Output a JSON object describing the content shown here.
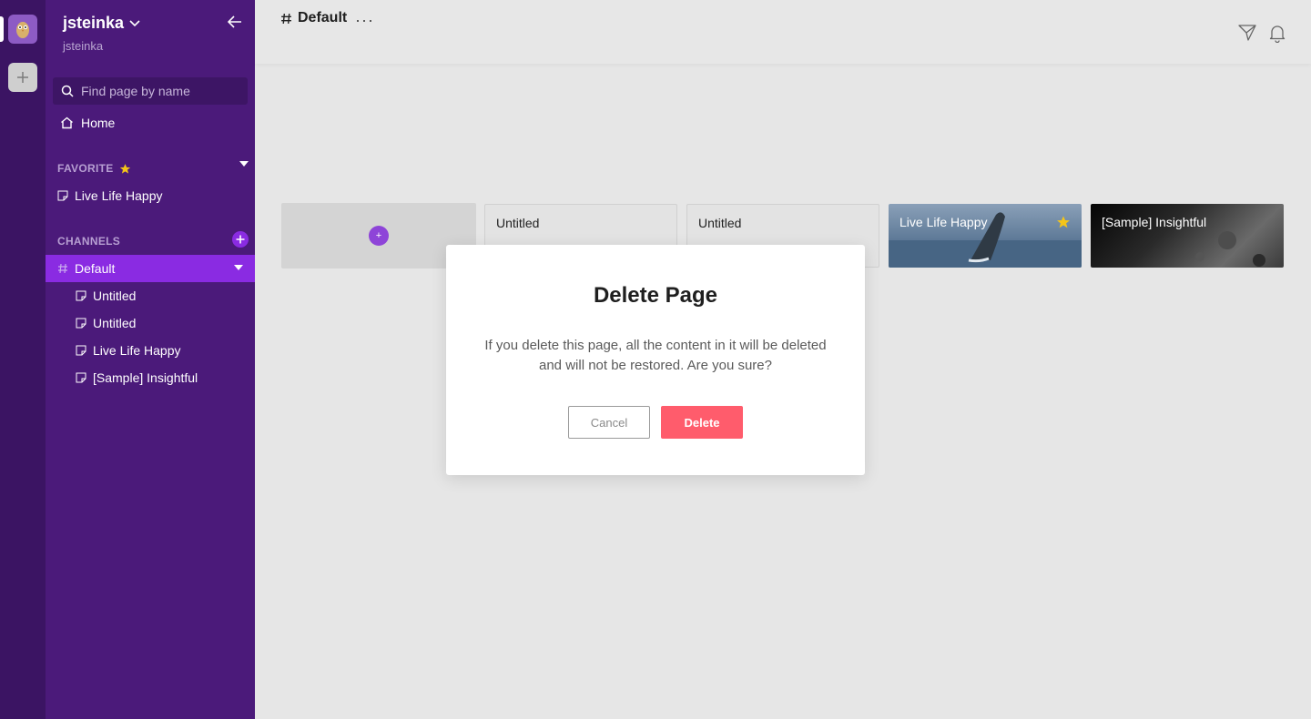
{
  "workspace": {
    "name": "jsteinka",
    "subtitle": "jsteinka"
  },
  "sidebar": {
    "search_placeholder": "Find page by name",
    "home_label": "Home",
    "favorite_header": "FAVORITE",
    "favorites": [
      {
        "label": "Live Life Happy"
      }
    ],
    "channels_header": "CHANNELS",
    "active_channel": "Default",
    "pages": [
      {
        "label": "Untitled"
      },
      {
        "label": "Untitled"
      },
      {
        "label": "Live Life Happy"
      },
      {
        "label": "[Sample] Insightful"
      }
    ]
  },
  "main": {
    "title": "Default",
    "more_label": "···",
    "cards": [
      {
        "title": "Untitled"
      },
      {
        "title": "Untitled"
      },
      {
        "title": "Live Life Happy",
        "starred": true
      },
      {
        "title": "[Sample] Insightful"
      }
    ]
  },
  "modal": {
    "title": "Delete Page",
    "message": "If you delete this page, all the content in it will be deleted and will not be restored. Are you sure?",
    "cancel_label": "Cancel",
    "delete_label": "Delete"
  },
  "colors": {
    "sidebar_bg": "#4b1a7a",
    "rail_bg": "#3b1463",
    "active_channel_bg": "#8a2be2",
    "delete_button": "#ff5c6c",
    "star": "#f5c518"
  }
}
